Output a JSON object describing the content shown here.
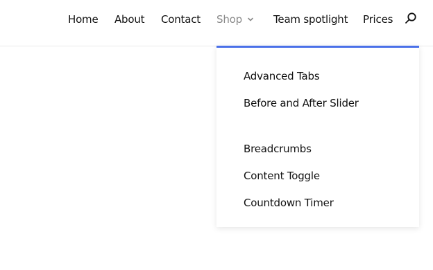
{
  "nav": {
    "items": [
      {
        "label": "Home"
      },
      {
        "label": "About"
      },
      {
        "label": "Contact"
      },
      {
        "label": "Shop"
      },
      {
        "label": "Team spotlight"
      },
      {
        "label": "Prices"
      }
    ],
    "search_icon": "search-icon",
    "dropdown_icon": "chevron-down-icon"
  },
  "dropdown": {
    "items": [
      {
        "label": "Advanced Tabs"
      },
      {
        "label": "Before and After Slider"
      },
      {
        "label": "Breadcrumbs"
      },
      {
        "label": "Content Toggle"
      },
      {
        "label": "Countdown Timer"
      }
    ]
  },
  "colors": {
    "accent": "#4a70e8",
    "active_nav": "#8a8a8a",
    "text": "#111111"
  }
}
